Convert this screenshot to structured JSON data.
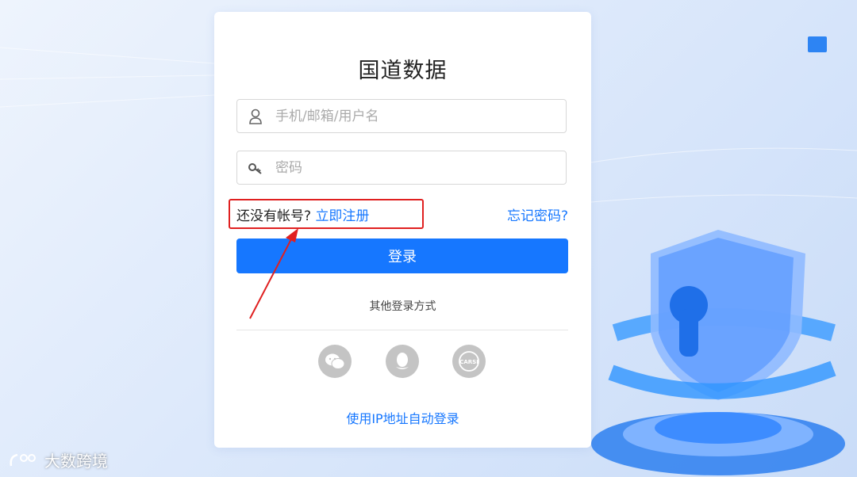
{
  "login": {
    "title": "国道数据",
    "username_placeholder": "手机/邮箱/用户名",
    "password_placeholder": "密码",
    "no_account": "还没有帐号?",
    "register": "立即注册",
    "forgot": "忘记密码?",
    "login_button": "登录",
    "other_methods": "其他登录方式",
    "ip_login": "使用IP地址自动登录",
    "social": [
      {
        "icon": "wechat-icon"
      },
      {
        "icon": "qq-icon"
      },
      {
        "icon": "carsi-icon",
        "label": "CARSI"
      }
    ]
  },
  "watermark": {
    "text": "大数跨境"
  },
  "colors": {
    "accent": "#1677ff",
    "highlight": "#e02020",
    "icon_bg": "#c4c4c4"
  }
}
